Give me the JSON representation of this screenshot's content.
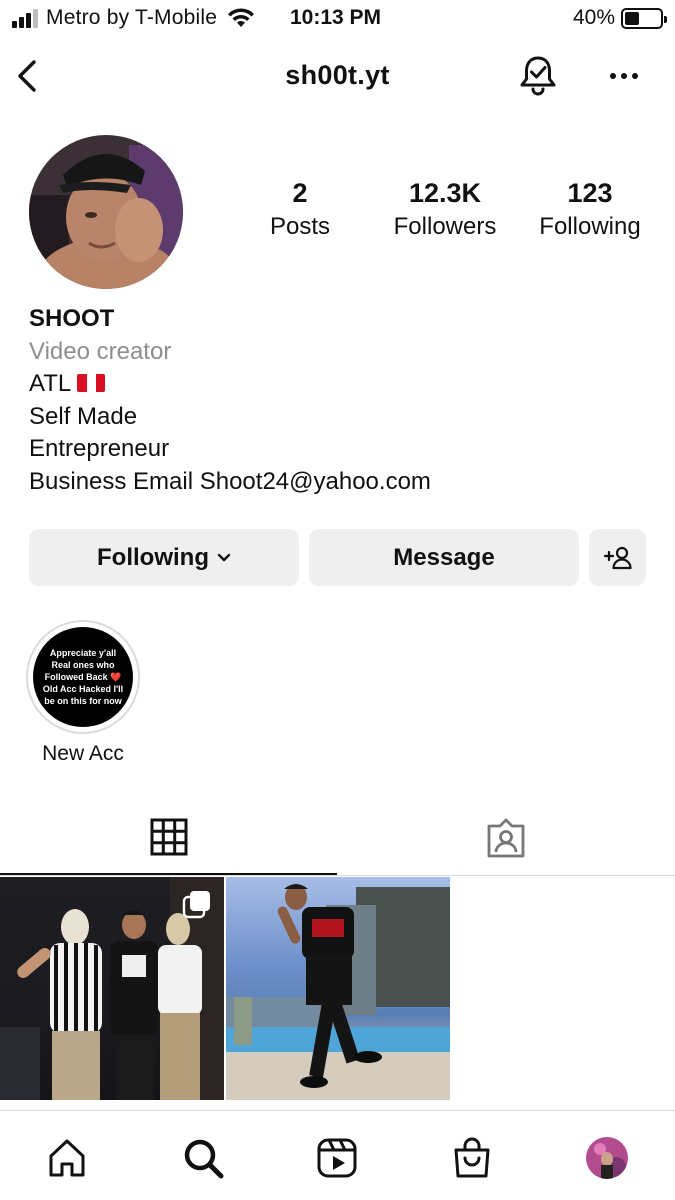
{
  "status_bar": {
    "carrier": "Metro by T-Mobile",
    "time": "10:13 PM",
    "battery_percent": "40%",
    "battery_level": 0.4,
    "signal_bars": 3,
    "icons": [
      "signal-icon",
      "wifi-icon",
      "battery-icon"
    ]
  },
  "header": {
    "username": "sh00t.yt",
    "icons": [
      "back-arrow-icon",
      "notification-bell-icon",
      "more-options-icon"
    ]
  },
  "profile": {
    "stats": [
      {
        "value": "2",
        "label": "Posts"
      },
      {
        "value": "12.3K",
        "label": "Followers"
      },
      {
        "value": "123",
        "label": "Following"
      }
    ],
    "name": "SHOOT",
    "category": "Video creator",
    "bio_lines": [
      "ATL",
      "Self Made",
      "Entrepreneur",
      "Business Email Shoot24@yahoo.com"
    ],
    "bio_flag": "peru-flag-icon"
  },
  "actions": {
    "following_label": "Following",
    "message_label": "Message",
    "icons": [
      "chevron-down-icon",
      "add-user-icon"
    ]
  },
  "highlights": [
    {
      "label": "New Acc",
      "cover_text": "Appreciate y'all Real ones who Followed Back ❤️ Old Acc Hacked I'll be on this for now"
    }
  ],
  "tabs": [
    {
      "name": "posts-grid",
      "icon": "grid-icon",
      "active": true
    },
    {
      "name": "tagged",
      "icon": "tagged-person-icon",
      "active": false
    }
  ],
  "posts": [
    {
      "type": "carousel",
      "icon": "multiple-posts-icon"
    },
    {
      "type": "photo"
    }
  ],
  "bottom_nav": [
    {
      "name": "home",
      "icon": "home-icon"
    },
    {
      "name": "search",
      "icon": "search-icon",
      "active": true
    },
    {
      "name": "reels",
      "icon": "reels-icon"
    },
    {
      "name": "shop",
      "icon": "shop-bag-icon"
    },
    {
      "name": "profile",
      "icon": "profile-avatar"
    }
  ],
  "colors": {
    "text": "#111111",
    "secondary_text": "#8e8e8e",
    "button_bg": "#efefef",
    "divider": "#dbdbdb",
    "flag_red": "#d91023"
  }
}
